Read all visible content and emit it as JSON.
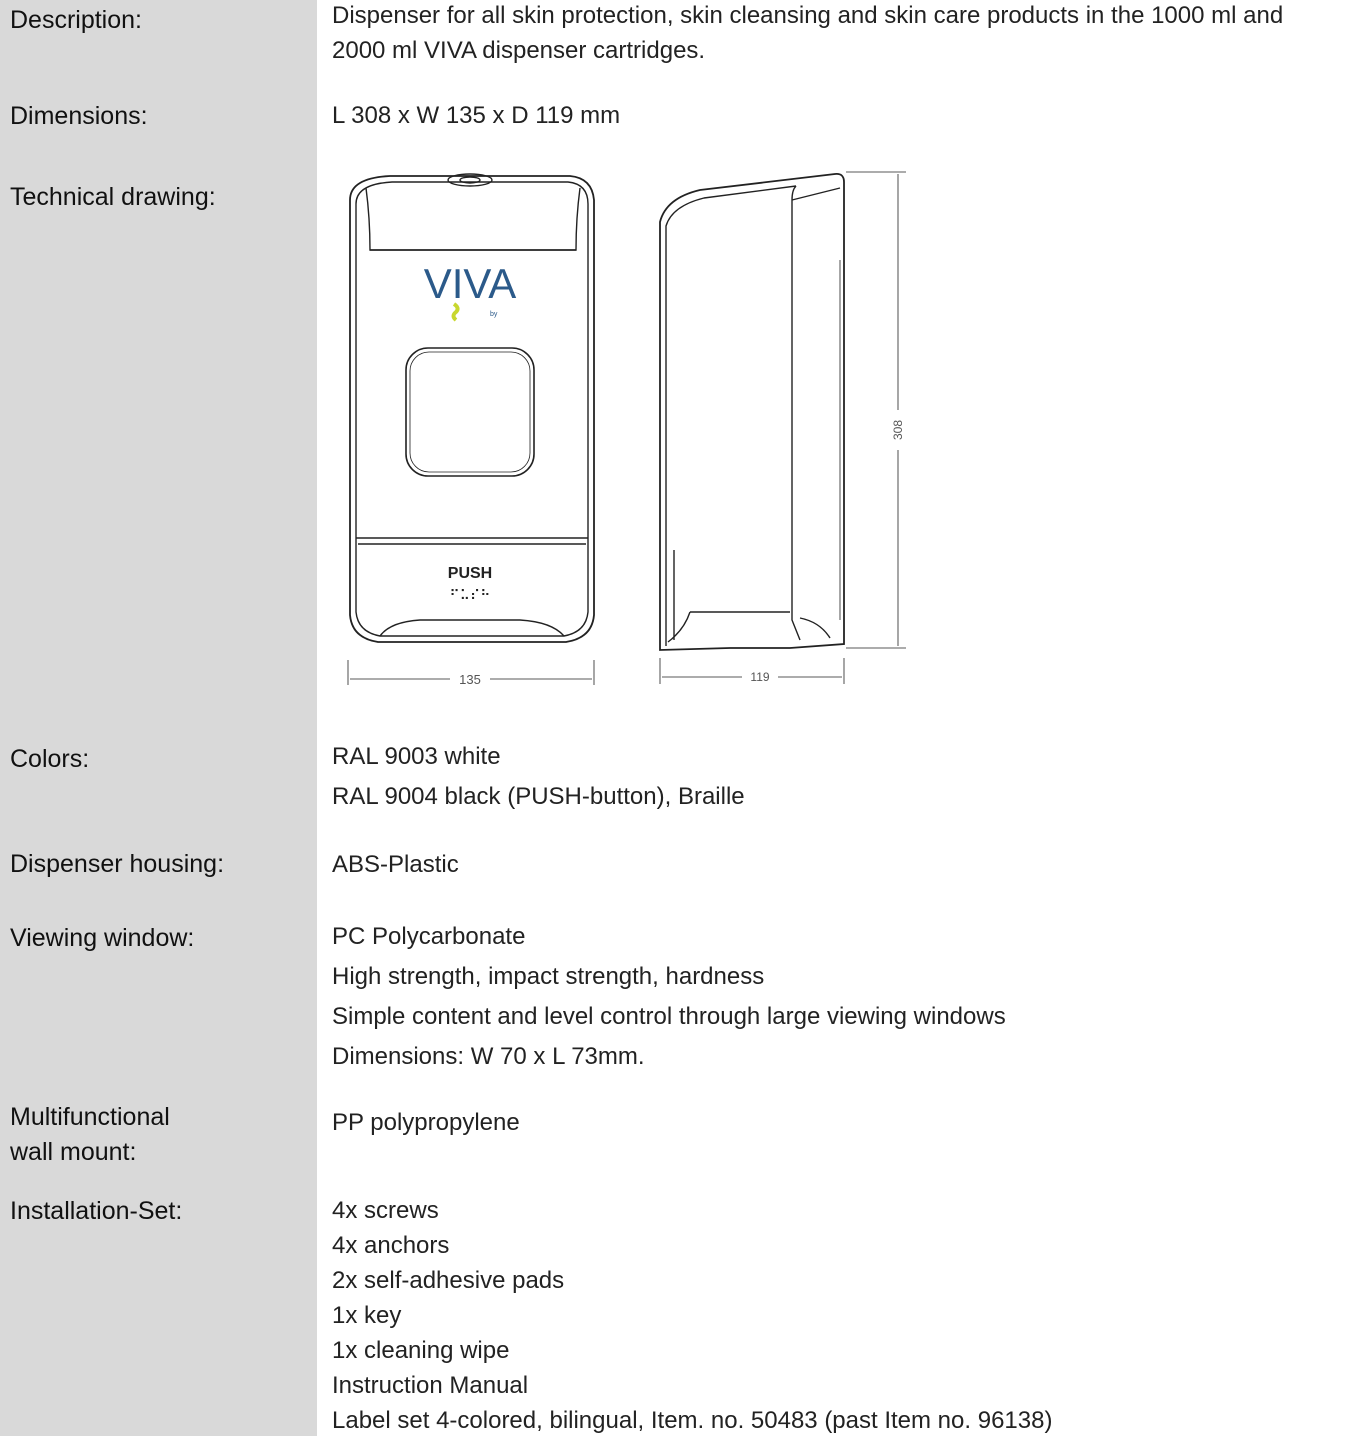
{
  "labels": {
    "description": "Description:",
    "dimensions": "Dimensions:",
    "technical_drawing": "Technical drawing:",
    "colors": "Colors:",
    "housing": "Dispenser housing:",
    "viewing_window": "Viewing window:",
    "wall_mount_line1": "Multifunctional",
    "wall_mount_line2": "wall mount:",
    "installation_set": "Installation-Set:"
  },
  "values": {
    "description": [
      "Dispenser for all skin protection, skin cleansing and skin care products in the 1000 ml and",
      "2000 ml VIVA dispenser cartridges."
    ],
    "dimensions": "L 308 x W 135 x D 119 mm",
    "colors": [
      "RAL 9003 white",
      "RAL 9004 black (PUSH-button), Braille"
    ],
    "housing": "ABS-Plastic",
    "viewing_window": [
      "PC Polycarbonate",
      "High strength, impact strength, hardness",
      "Simple content and level control through large viewing windows",
      "Dimensions: W 70 x L 73mm."
    ],
    "wall_mount": "PP polypropylene",
    "installation_set": [
      "4x screws",
      "4x anchors",
      "2x self-adhesive pads",
      "1x key",
      "1x cleaning wipe",
      "Instruction Manual",
      "Label set 4-colored, bilingual, Item. no. 50483 (past Item no. 96138)"
    ]
  },
  "drawing": {
    "brand": "VIVA",
    "brand_sub": "by",
    "push_label": "PUSH",
    "braille": "⠋⠥⠎⠓",
    "width_dim": "135",
    "depth_dim": "119",
    "height_dim": "308",
    "accent_color": "#c8d72e",
    "brand_color": "#2b5a8a"
  }
}
